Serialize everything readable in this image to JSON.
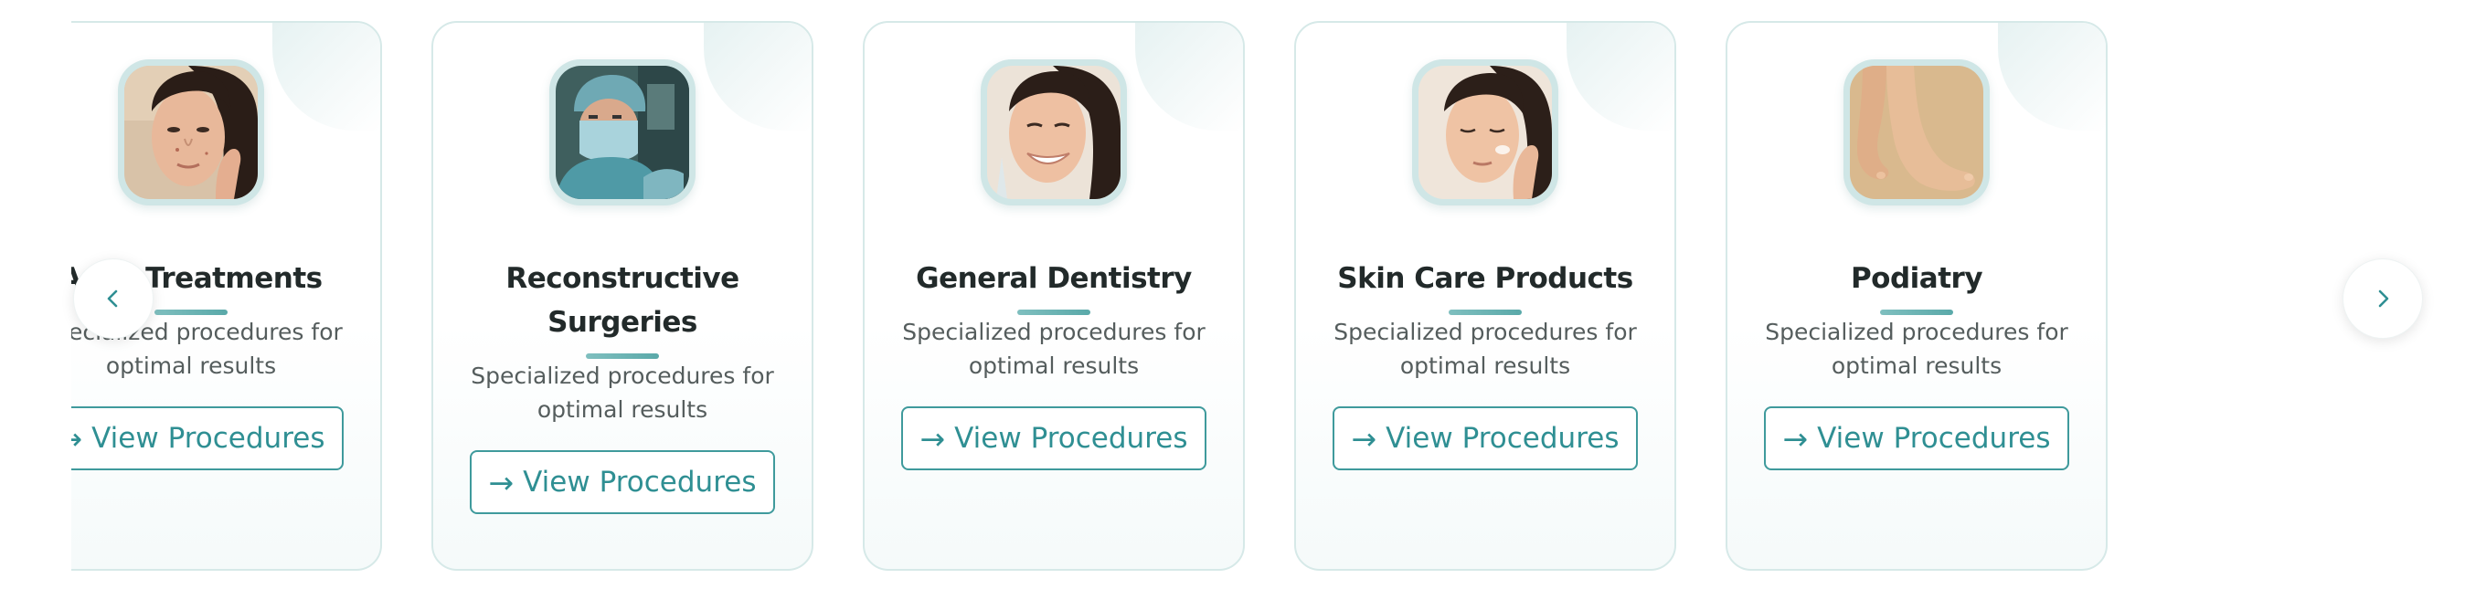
{
  "carousel": {
    "prev_icon": "chevron-left-icon",
    "next_icon": "chevron-right-icon",
    "accent_color": "#2f8f93",
    "cards": [
      {
        "title": "Acne Treatments",
        "description": "Specialized procedures for optimal results",
        "button_label": "View Procedures",
        "button_icon": "arrow-right-icon",
        "photo": "woman-touching-cheek-acne-photo"
      },
      {
        "title": "Reconstructive Surgeries",
        "description": "Specialized procedures for optimal results",
        "button_label": "View Procedures",
        "button_icon": "arrow-right-icon",
        "photo": "surgeon-in-operating-room-photo"
      },
      {
        "title": "General Dentistry",
        "description": "Specialized procedures for optimal results",
        "button_label": "View Procedures",
        "button_icon": "arrow-right-icon",
        "photo": "smiling-woman-dental-photo"
      },
      {
        "title": "Skin Care Products",
        "description": "Specialized procedures for optimal results",
        "button_label": "View Procedures",
        "button_icon": "arrow-right-icon",
        "photo": "woman-applying-skincare-photo"
      },
      {
        "title": "Podiatry",
        "description": "Specialized procedures for optimal results",
        "button_label": "View Procedures",
        "button_icon": "arrow-right-icon",
        "photo": "bare-feet-photo"
      }
    ]
  }
}
